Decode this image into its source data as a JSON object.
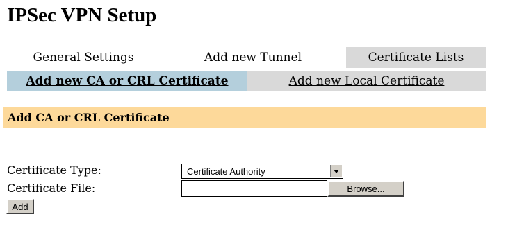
{
  "page": {
    "title": "IPSec VPN Setup"
  },
  "tabs": [
    {
      "label": "General Settings",
      "active": false
    },
    {
      "label": "Add new Tunnel",
      "active": false
    },
    {
      "label": "Certificate Lists",
      "active": true
    }
  ],
  "subtabs": [
    {
      "label": "Add new CA or CRL Certificate",
      "active": true
    },
    {
      "label": "Add new Local Certificate",
      "active": false
    }
  ],
  "section": {
    "title": "Add CA or CRL Certificate"
  },
  "form": {
    "cert_type_label": "Certificate Type:",
    "cert_type_value": "Certificate Authority",
    "cert_file_label": "Certificate File:",
    "cert_file_value": "",
    "browse_label": "Browse...",
    "add_label": "Add"
  },
  "colors": {
    "active_subtab": "#b4cfdc",
    "inactive_tab": "#d9d9d9",
    "section_bar": "#fdd99a"
  }
}
